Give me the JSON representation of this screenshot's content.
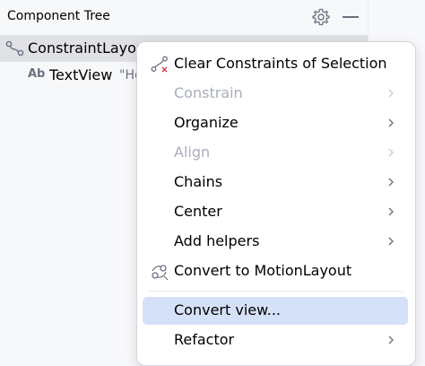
{
  "panel": {
    "title": "Component Tree",
    "settings_icon": "gear-icon",
    "minimize_icon": "minimize-icon"
  },
  "tree": {
    "rows": [
      {
        "icon": "constraint-layout-icon",
        "label": "ConstraintLayout",
        "selected": true
      },
      {
        "icon": "textview-ab-icon",
        "icon_text": "Ab",
        "label": "TextView",
        "hint": "\"Hello World!\""
      }
    ]
  },
  "context_menu": {
    "items": [
      {
        "label": "Clear Constraints of Selection",
        "icon": "clear-constraints-icon",
        "enabled": true,
        "submenu": false
      },
      {
        "label": "Constrain",
        "enabled": false,
        "submenu": true
      },
      {
        "label": "Organize",
        "enabled": true,
        "submenu": true
      },
      {
        "label": "Align",
        "enabled": false,
        "submenu": true
      },
      {
        "label": "Chains",
        "enabled": true,
        "submenu": true
      },
      {
        "label": "Center",
        "enabled": true,
        "submenu": true
      },
      {
        "label": "Add helpers",
        "enabled": true,
        "submenu": true
      },
      {
        "label": "Convert to MotionLayout",
        "icon": "motion-layout-icon",
        "enabled": true,
        "submenu": false
      },
      {
        "label": "Convert view...",
        "enabled": true,
        "submenu": false,
        "highlighted": true
      },
      {
        "label": "Refactor",
        "enabled": true,
        "submenu": true
      }
    ]
  },
  "colors": {
    "highlight": "#d5e1f8",
    "selected_row": "#dfe1e5",
    "disabled_text": "#a8adbd",
    "clear_icon_accent": "#db3b4b"
  }
}
